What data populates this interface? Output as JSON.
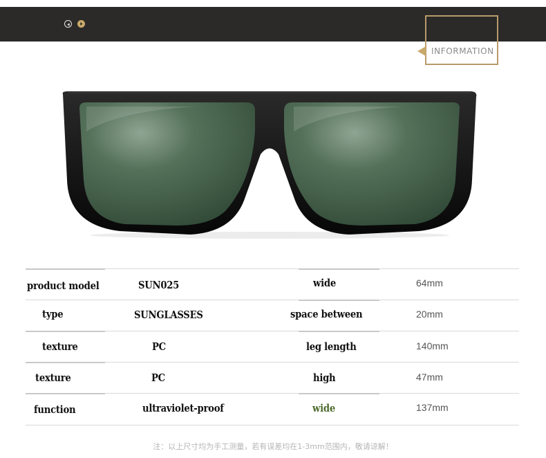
{
  "header": {
    "info_label": "INFORMATION",
    "accent_color": "#b89b6a",
    "bar_color": "#2b2a29",
    "prev_icon": "circle-left-arrow-icon",
    "next_icon": "circle-right-arrow-icon"
  },
  "product_image": {
    "subject": "sunglasses",
    "lens_color": "#3f5a45"
  },
  "specs": [
    {
      "label1": "product model",
      "value1": "SUN025",
      "label2": "wide",
      "value2": "64mm"
    },
    {
      "label1": "type",
      "value1": "SUNGLASSES",
      "label2": "space between",
      "value2": "20mm"
    },
    {
      "label1": "texture",
      "value1": "PC",
      "label2": "leg length",
      "value2": "140mm"
    },
    {
      "label1": "texture",
      "value1": "PC",
      "label2": "high",
      "value2": "47mm"
    },
    {
      "label1": "function",
      "value1": "ultraviolet-proof",
      "label2": "wide",
      "value2": "137mm"
    }
  ],
  "note": "注：以上尺寸均为手工测量，若有误差均在1-3mm范围内，敬请谅解！"
}
